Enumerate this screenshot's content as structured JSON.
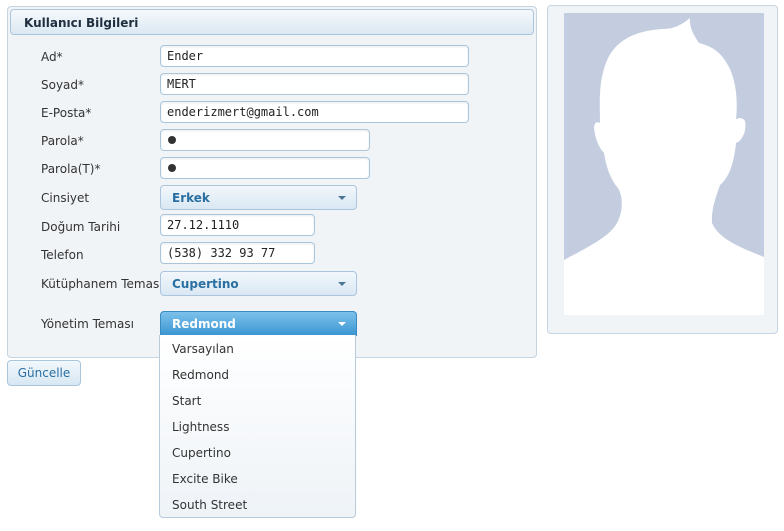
{
  "panel": {
    "title": "Kullanıcı Bilgileri"
  },
  "form": {
    "name_label": "Ad*",
    "name_value": "Ender",
    "surname_label": "Soyad*",
    "surname_value": "MERT",
    "email_label": "E-Posta*",
    "email_value": "enderizmert@gmail.com",
    "password_label": "Parola*",
    "password_confirm_label": "Parola(T)*",
    "gender_label": "Cinsiyet",
    "gender_value": "Erkek",
    "birthdate_label": "Doğum Tarihi",
    "birthdate_value": "27.12.1110",
    "phone_label": "Telefon",
    "phone_value": "(538) 332 93 77",
    "library_theme_label": "Kütüphanem Teması",
    "library_theme_value": "Cupertino",
    "admin_theme_label": "Yönetim Teması",
    "admin_theme_value": "Redmond"
  },
  "theme_options": [
    "Varsayılan",
    "Redmond",
    "Start",
    "Lightness",
    "Cupertino",
    "Excite Bike",
    "South Street"
  ],
  "buttons": {
    "update": "Güncelle"
  },
  "colors": {
    "accent": "#3c96d1",
    "silhouette": "#c4cde0",
    "panel_bg": "#f1f4f7",
    "border": "#aac5dc"
  }
}
